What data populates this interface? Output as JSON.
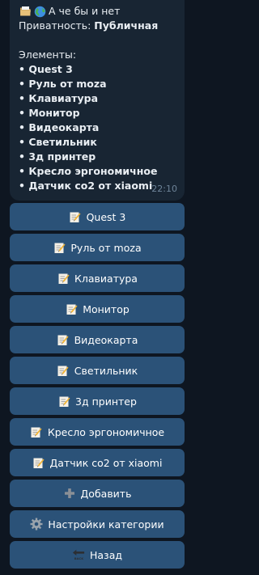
{
  "message": {
    "title": "А че бы и нет",
    "privacy_label": "Приватность: ",
    "privacy_value": "Публичная",
    "items_header": "Элементы:",
    "items": [
      "• Quest 3",
      "• Руль от moza",
      "• Клавиатура",
      "• Монитор",
      "• Видеокарта",
      "• Светильник",
      "• 3д принтер",
      "• Кресло эргономичное",
      "• Датчик co2 от xiaomi"
    ],
    "time": "22:10",
    "icons": [
      "folder-icon",
      "globe-icon"
    ]
  },
  "buttons": [
    {
      "label": "Quest 3",
      "icon": "memo-icon"
    },
    {
      "label": "Руль от moza",
      "icon": "memo-icon"
    },
    {
      "label": "Клавиатура",
      "icon": "memo-icon"
    },
    {
      "label": "Монитор",
      "icon": "memo-icon"
    },
    {
      "label": "Видеокарта",
      "icon": "memo-icon"
    },
    {
      "label": "Светильник",
      "icon": "memo-icon"
    },
    {
      "label": "3д принтер",
      "icon": "memo-icon"
    },
    {
      "label": "Кресло эргономичное",
      "icon": "memo-icon"
    },
    {
      "label": "Датчик co2 от xiaomi",
      "icon": "memo-icon"
    },
    {
      "label": "Добавить",
      "icon": "plus-icon"
    },
    {
      "label": "Настройки категории",
      "icon": "gear-icon"
    },
    {
      "label": "Назад",
      "icon": "back-arrow-icon"
    }
  ],
  "colors": {
    "background": "#0e1621",
    "bubble": "#182533",
    "button": "#2b5278",
    "time": "#6d8398"
  }
}
